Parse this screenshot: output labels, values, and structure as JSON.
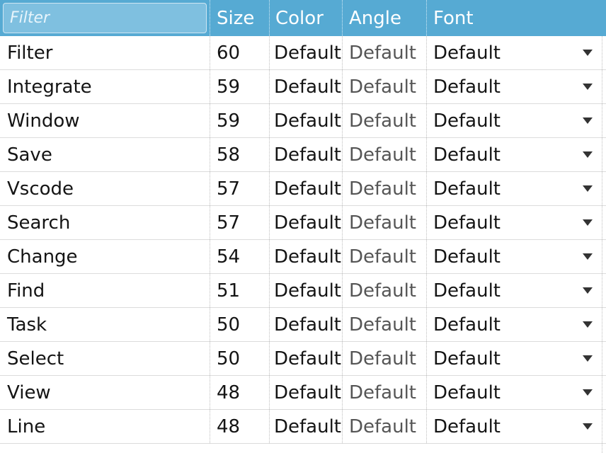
{
  "header": {
    "filter_placeholder": "Filter",
    "columns": [
      "Size",
      "Color",
      "Angle",
      "Font"
    ]
  },
  "rows": [
    {
      "name": "Filter",
      "size": "60",
      "color": "Default",
      "angle": "Default",
      "font": "Default"
    },
    {
      "name": "Integrate",
      "size": "59",
      "color": "Default",
      "angle": "Default",
      "font": "Default"
    },
    {
      "name": "Window",
      "size": "59",
      "color": "Default",
      "angle": "Default",
      "font": "Default"
    },
    {
      "name": "Save",
      "size": "58",
      "color": "Default",
      "angle": "Default",
      "font": "Default"
    },
    {
      "name": "Vscode",
      "size": "57",
      "color": "Default",
      "angle": "Default",
      "font": "Default"
    },
    {
      "name": "Search",
      "size": "57",
      "color": "Default",
      "angle": "Default",
      "font": "Default"
    },
    {
      "name": "Change",
      "size": "54",
      "color": "Default",
      "angle": "Default",
      "font": "Default"
    },
    {
      "name": "Find",
      "size": "51",
      "color": "Default",
      "angle": "Default",
      "font": "Default"
    },
    {
      "name": "Task",
      "size": "50",
      "color": "Default",
      "angle": "Default",
      "font": "Default"
    },
    {
      "name": "Select",
      "size": "50",
      "color": "Default",
      "angle": "Default",
      "font": "Default"
    },
    {
      "name": "View",
      "size": "48",
      "color": "Default",
      "angle": "Default",
      "font": "Default"
    },
    {
      "name": "Line",
      "size": "48",
      "color": "Default",
      "angle": "Default",
      "font": "Default"
    }
  ],
  "colors": {
    "header_bg": "#56aad3",
    "filter_bg": "#7fc0e0",
    "text": "#141414",
    "angle_text": "#555555"
  },
  "icons": {
    "font_dropdown": "triangle-down-icon"
  }
}
